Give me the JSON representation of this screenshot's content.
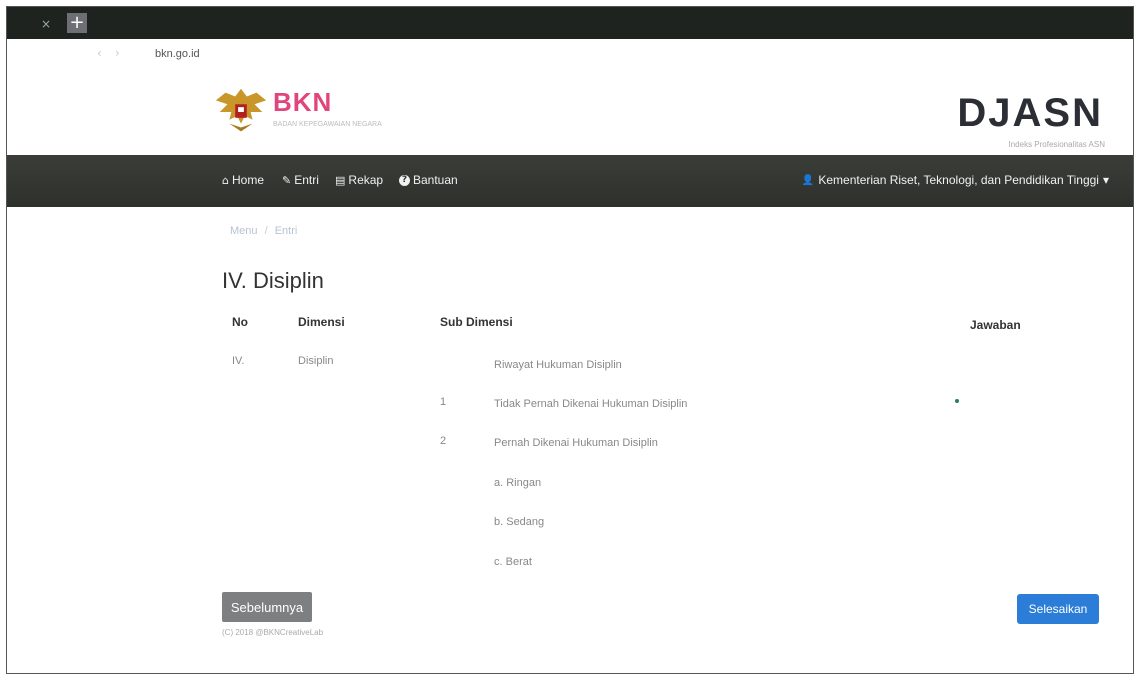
{
  "browser": {
    "tab_close": "×",
    "new_tab": "+",
    "url": "bkn.go.id"
  },
  "header": {
    "logo_text": "BKN",
    "logo_subtitle": "BADAN KEPEGAWAIAN NEGARA",
    "brand": "DJASN",
    "brand_subtitle": "Indeks Profesionalitas ASN"
  },
  "nav": {
    "items": [
      {
        "icon": "home-icon",
        "glyph": "⌂",
        "label": "Home"
      },
      {
        "icon": "pencil-icon",
        "glyph": "✎",
        "label": "Entri"
      },
      {
        "icon": "book-icon",
        "glyph": "▤",
        "label": "Rekap"
      },
      {
        "icon": "question-icon",
        "glyph": "?",
        "label": "Bantuan"
      }
    ],
    "user_glyph": "👤",
    "user": "Kementerian Riset, Teknologi, dan Pendidikan Tinggi",
    "caret": "▾"
  },
  "breadcrumb": {
    "items": [
      "Menu",
      "Entri"
    ],
    "separator": "/"
  },
  "page_title": "IV. Disiplin",
  "table": {
    "headers": {
      "no": "No",
      "dimensi": "Dimensi",
      "sub_dimensi": "Sub Dimensi",
      "jawaban": "Jawaban"
    },
    "row": {
      "no": "IV.",
      "dimensi": "Disiplin"
    },
    "sub_title": "Riwayat Hukuman Disiplin",
    "options": [
      {
        "no": "1",
        "label": "Tidak Pernah Dikenai Hukuman Disiplin"
      },
      {
        "no": "2",
        "label": "Pernah Dikenai Hukuman Disiplin"
      }
    ],
    "sub_options": [
      "a. Ringan",
      "b. Sedang",
      "c. Berat"
    ]
  },
  "buttons": {
    "prev": "Sebelumnya",
    "finish": "Selesaikan"
  },
  "footer": "(C) 2018 @BKNCreativeLab",
  "colors": {
    "navbar": "#33362f",
    "accent": "#2b7dd8",
    "logo": "#e0457b",
    "prev_button": "#7d7f80"
  }
}
